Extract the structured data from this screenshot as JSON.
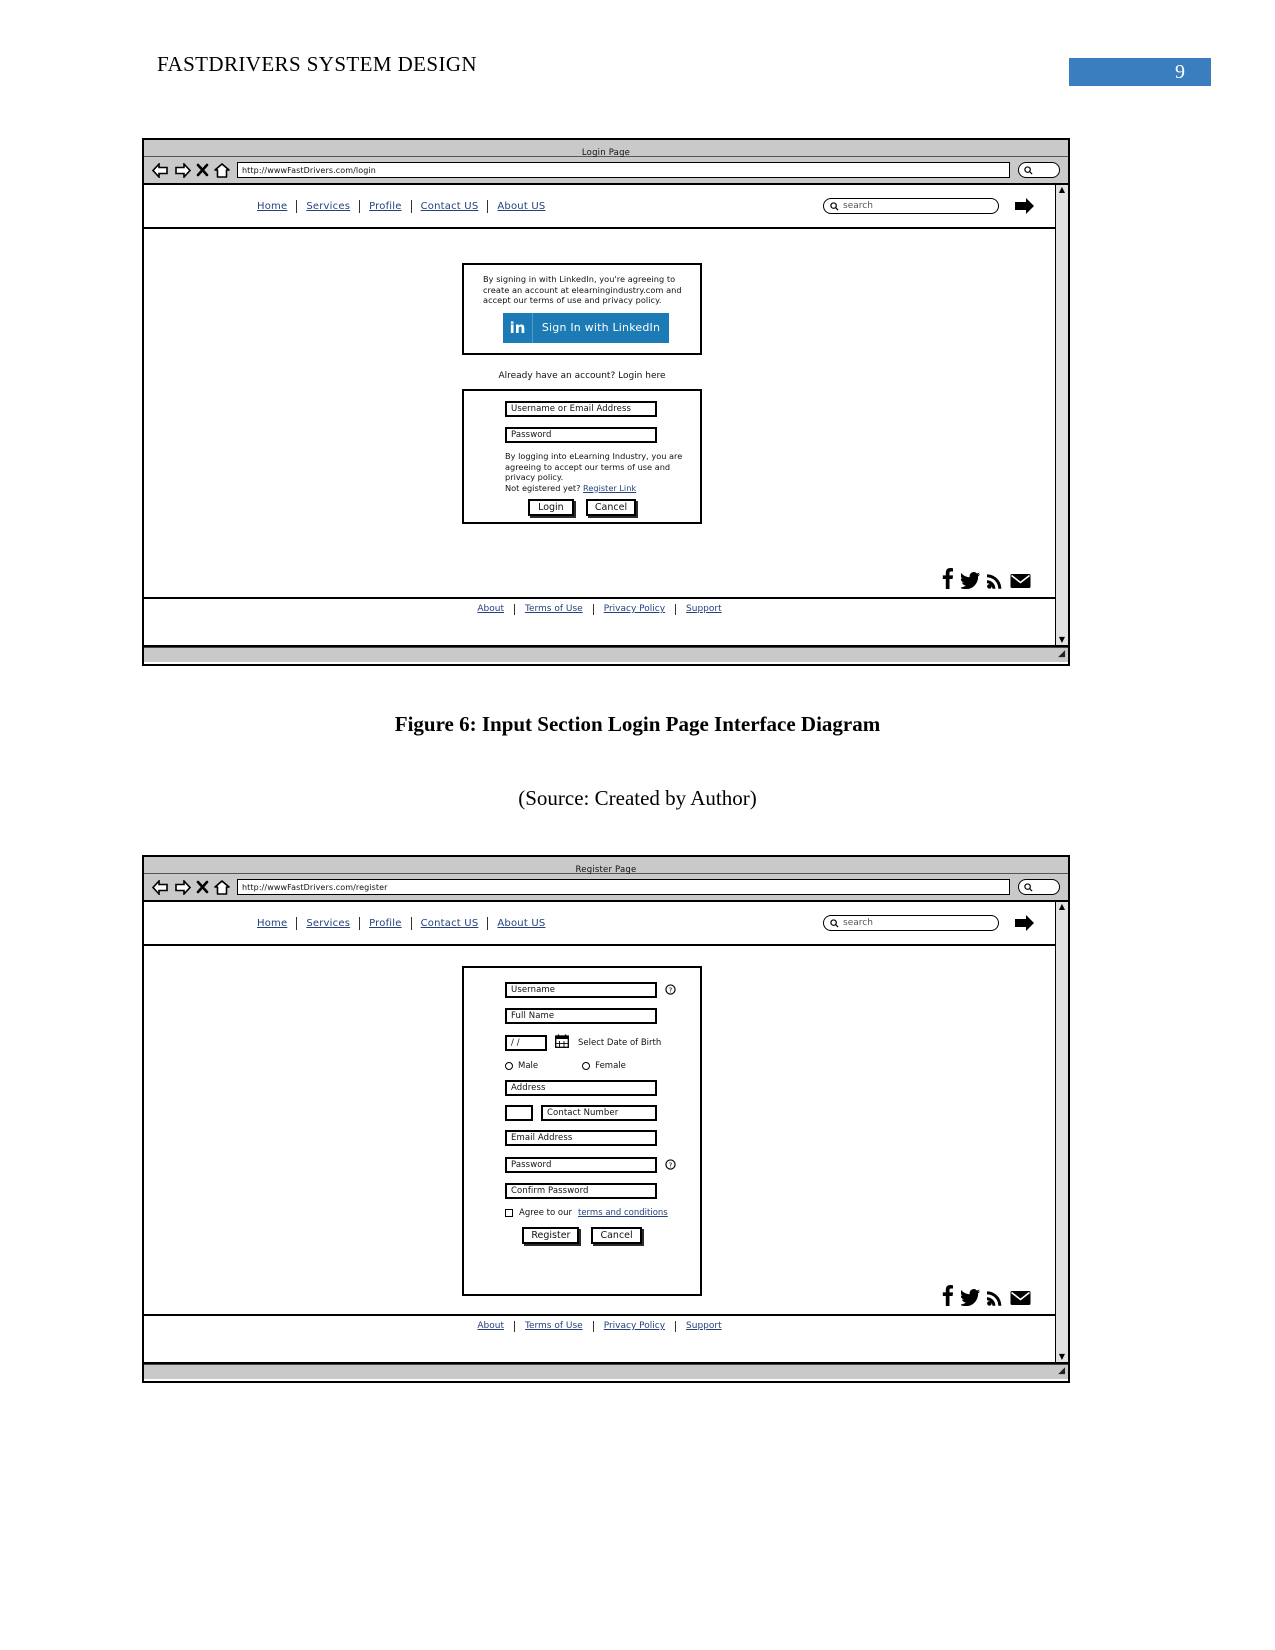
{
  "document": {
    "header_title": "FASTDRIVERS SYSTEM DESIGN",
    "page_number": "9",
    "header_accent_color": "#3a7ec0",
    "figure_caption": "Figure 6: Input Section Login Page Interface Diagram",
    "figure_source": "(Source: Created by Author)"
  },
  "login_wireframe": {
    "window_title": "Login Page",
    "url": "http://wwwFastDrivers.com/login",
    "nav_links": [
      "Home",
      "Services",
      "Profile",
      "Contact US",
      "About US"
    ],
    "search_placeholder": "search",
    "linkedin": {
      "terms_text": "By signing in with LinkedIn, you're agreeing to create an account at elearningindustry.com and accept our terms of use and privacy policy.",
      "icon_label": "in",
      "button_label": "Sign In with LinkedIn",
      "button_color": "#1c7bb5"
    },
    "already_account_text": "Already have an account? Login here",
    "form": {
      "username_field": "Username or Email Address",
      "password_field": "Password",
      "terms_text": "By logging into eLearning Industry, you are agreeing to accept our terms of use and privacy policy.",
      "register_prompt": "Not egistered yet?",
      "register_link": "Register Link",
      "submit_label": "Login",
      "cancel_label": "Cancel"
    },
    "social_icons": [
      "facebook-icon",
      "twitter-icon",
      "rss-icon",
      "email-icon"
    ],
    "footer_links": [
      "About",
      "Terms of Use",
      "Privacy Policy",
      "Support"
    ]
  },
  "register_wireframe": {
    "window_title": "Register Page",
    "url": "http://wwwFastDrivers.com/register",
    "nav_links": [
      "Home",
      "Services",
      "Profile",
      "Contact US",
      "About US"
    ],
    "search_placeholder": "search",
    "form": {
      "username_field": "Username",
      "fullname_field": "Full Name",
      "dob_field": "/ /",
      "dob_label": "Select Date of Birth",
      "gender_male": "Male",
      "gender_female": "Female",
      "address_field": "Address",
      "country_code_field": "",
      "contact_field": "Contact Number",
      "email_field": "Email Address",
      "password_field": "Password",
      "confirm_password_field": "Confirm Password",
      "agree_text": "Agree to our",
      "terms_link": "terms and conditions",
      "submit_label": "Register",
      "cancel_label": "Cancel"
    },
    "social_icons": [
      "facebook-icon",
      "twitter-icon",
      "rss-icon",
      "email-icon"
    ],
    "footer_links": [
      "About",
      "Terms of Use",
      "Privacy Policy",
      "Support"
    ]
  }
}
